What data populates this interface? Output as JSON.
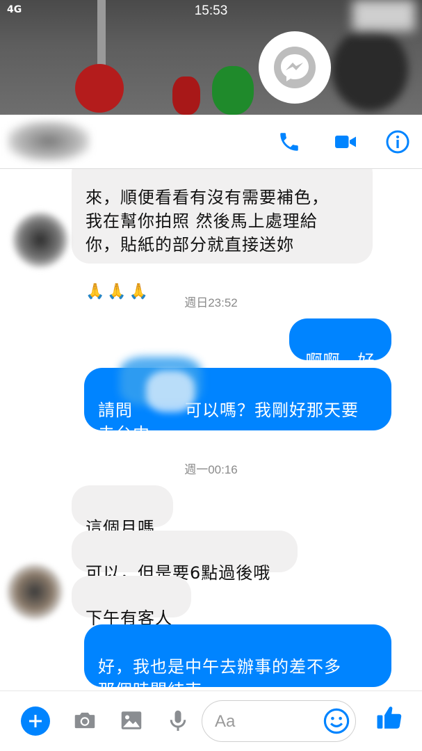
{
  "status_bar": {
    "time": "15:53",
    "signal": "4G"
  },
  "header": {
    "call_icon": "phone-icon",
    "video_icon": "video-camera-icon",
    "info_icon": "info-icon",
    "accent": "#0084ff"
  },
  "messages": [
    {
      "side": "in",
      "text": "來，順便看看有沒有需要補色，\n我在幫你拍照 然後馬上處理給\n你，貼紙的部分就直接送妳",
      "emoji": "🙏🙏🙏"
    },
    {
      "side": "timestamp",
      "text": "週日23:52"
    },
    {
      "side": "out",
      "text": "啊啊，好"
    },
    {
      "side": "out",
      "text": "請問　　　可以嗎？我剛好那天要\n去台中"
    },
    {
      "side": "timestamp",
      "text": "週一00:16"
    },
    {
      "side": "in",
      "text": "這個月嗎"
    },
    {
      "side": "in",
      "text": "可以，但是要6點過後哦"
    },
    {
      "side": "in",
      "text": "下午有客人"
    },
    {
      "side": "out",
      "text": "好，我也是中午去辦事的差不多\n那個時間結束"
    }
  ],
  "composer": {
    "placeholder": "Aa",
    "icons": [
      "plus-icon",
      "camera-icon",
      "image-icon",
      "microphone-icon",
      "emoji-icon",
      "thumbs-up-icon"
    ]
  }
}
